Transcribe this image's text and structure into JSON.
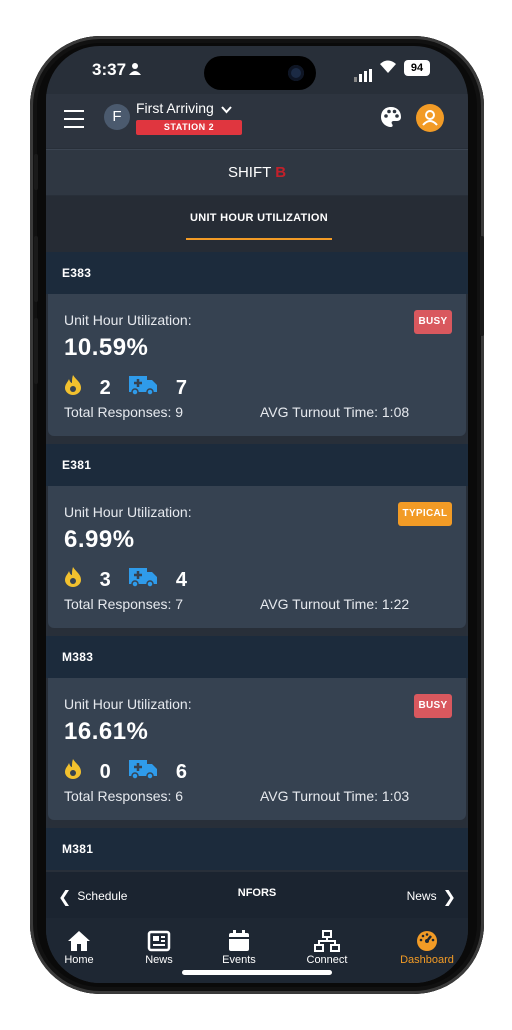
{
  "status_bar": {
    "time": "3:37",
    "battery": "94"
  },
  "header": {
    "avatar_letter": "F",
    "org_name": "First Arriving",
    "station": "STATION 2"
  },
  "shift": {
    "label": "SHIFT",
    "letter": "B"
  },
  "tab": {
    "label": "UNIT HOUR UTILIZATION"
  },
  "units": [
    {
      "name": "E383",
      "util_label": "Unit Hour Utilization:",
      "util_value": "10.59%",
      "badge": "BUSY",
      "fire": "2",
      "ems": "7",
      "total": "Total Responses: 9",
      "turnout": "AVG Turnout Time: 1:08"
    },
    {
      "name": "E381",
      "util_label": "Unit Hour Utilization:",
      "util_value": "6.99%",
      "badge": "TYPICAL",
      "fire": "3",
      "ems": "4",
      "total": "Total Responses: 7",
      "turnout": "AVG Turnout Time: 1:22"
    },
    {
      "name": "M383",
      "util_label": "Unit Hour Utilization:",
      "util_value": "16.61%",
      "badge": "BUSY",
      "fire": "0",
      "ems": "6",
      "total": "Total Responses: 6",
      "turnout": "AVG Turnout Time: 1:03"
    },
    {
      "name": "M381"
    }
  ],
  "pager": {
    "prev": "Schedule",
    "current": "NFORS",
    "next": "News"
  },
  "tabbar": {
    "home": "Home",
    "news": "News",
    "events": "Events",
    "connect": "Connect",
    "dashboard": "Dashboard"
  },
  "colors": {
    "accent": "#f29b26",
    "busy": "#d9585e",
    "typical": "#f29b26",
    "station": "#e0363f",
    "ems_icon": "#2f9bea",
    "fire_icon": "#f2c12e"
  }
}
